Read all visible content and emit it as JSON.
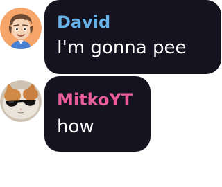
{
  "messages": [
    {
      "author": "David",
      "author_color": "#66b3ea",
      "text": "I'm gonna pee",
      "avatar_icon": "cartoon-boy-avatar"
    },
    {
      "author": "MitkoYT",
      "author_color": "#ea5c9c",
      "text": "how",
      "avatar_icon": "cat-with-sunglasses-avatar"
    }
  ]
}
